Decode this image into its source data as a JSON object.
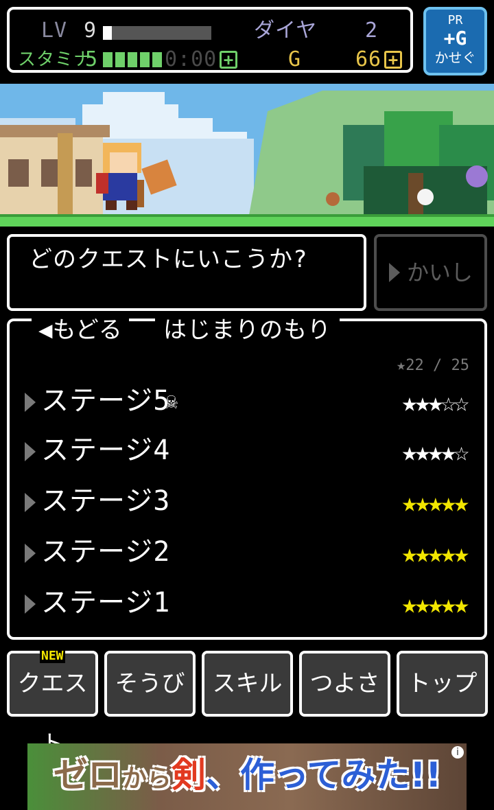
{
  "status": {
    "level_label": "LV",
    "level_value": "9",
    "level_progress": 0.08,
    "diamond_label": "ダイヤ",
    "diamond_value": "2",
    "stamina_label": "スタミナ",
    "stamina_value": "5",
    "stamina_segments_filled": 5,
    "stamina_segments_total": 5,
    "stamina_timer": "0:00",
    "gold_label": "G",
    "gold_value": "66",
    "plus_symbol": "+"
  },
  "pr_button": {
    "line1": "PR",
    "line2": "+G",
    "line3": "かせぐ"
  },
  "dialog": {
    "text": "どのクエストにいこうか?"
  },
  "giveup_button": {
    "label": "かいし"
  },
  "quest_panel": {
    "back_label": "◀もどる",
    "area_title": "はじまりのもり",
    "star_total": "22 / 25",
    "stages": [
      {
        "label": "ステージ5",
        "boss": true,
        "stars": 3
      },
      {
        "label": "ステージ4",
        "boss": false,
        "stars": 4
      },
      {
        "label": "ステージ3",
        "boss": false,
        "stars": 5
      },
      {
        "label": "ステージ2",
        "boss": false,
        "stars": 5
      },
      {
        "label": "ステージ1",
        "boss": false,
        "stars": 5
      }
    ]
  },
  "nav": {
    "new_badge": "NEW",
    "tabs": [
      "クエスト",
      "そうび",
      "スキル",
      "つよさ",
      "トップ"
    ]
  },
  "ad": {
    "part1": "ゼロ",
    "part2": "から",
    "part3": "剣",
    "part4": "、",
    "part5": "作ってみた!!",
    "info": "i"
  },
  "colors": {
    "star_full_gold": "#f2e600",
    "star_full_white": "#ffffff",
    "star_empty": "#ffffff",
    "pr_bg": "#1b6bb0",
    "stamina_green": "#6fd06a"
  }
}
